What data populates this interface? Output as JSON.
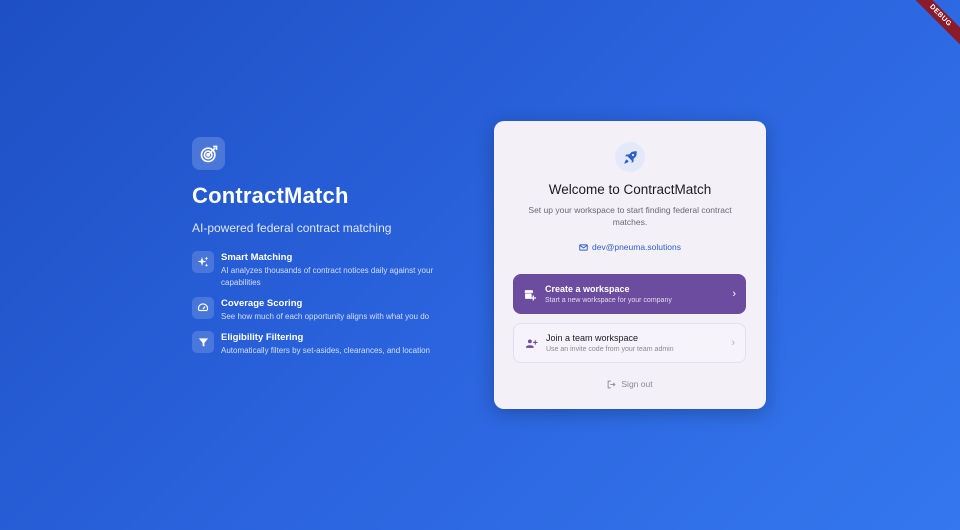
{
  "debug_banner": "DEBUG",
  "brand": {
    "name": "ContractMatch",
    "tagline": "AI-powered federal contract matching",
    "logo_icon": "target-icon"
  },
  "features": [
    {
      "icon": "sparkle-icon",
      "title": "Smart Matching",
      "desc": "AI analyzes thousands of contract notices daily against your capabilities"
    },
    {
      "icon": "gauge-icon",
      "title": "Coverage Scoring",
      "desc": "See how much of each opportunity aligns with what you do"
    },
    {
      "icon": "filter-icon",
      "title": "Eligibility Filtering",
      "desc": "Automatically filters by set-asides, clearances, and location"
    }
  ],
  "card": {
    "icon": "rocket-icon",
    "title": "Welcome to ContractMatch",
    "subtitle": "Set up your workspace to start finding federal contract matches.",
    "email": "dev@pneuma.solutions",
    "options": [
      {
        "icon": "add-business-icon",
        "title": "Create a workspace",
        "desc": "Start a new workspace for your company"
      },
      {
        "icon": "group-add-icon",
        "title": "Join a team workspace",
        "desc": "Use an invite code from your team admin"
      }
    ],
    "sign_out": "Sign out"
  },
  "colors": {
    "background_start": "#1e4fc4",
    "background_end": "#3477ee",
    "primary_option": "#6b4c9e",
    "card": "#f4f0f8",
    "link": "#2d5fc9"
  }
}
